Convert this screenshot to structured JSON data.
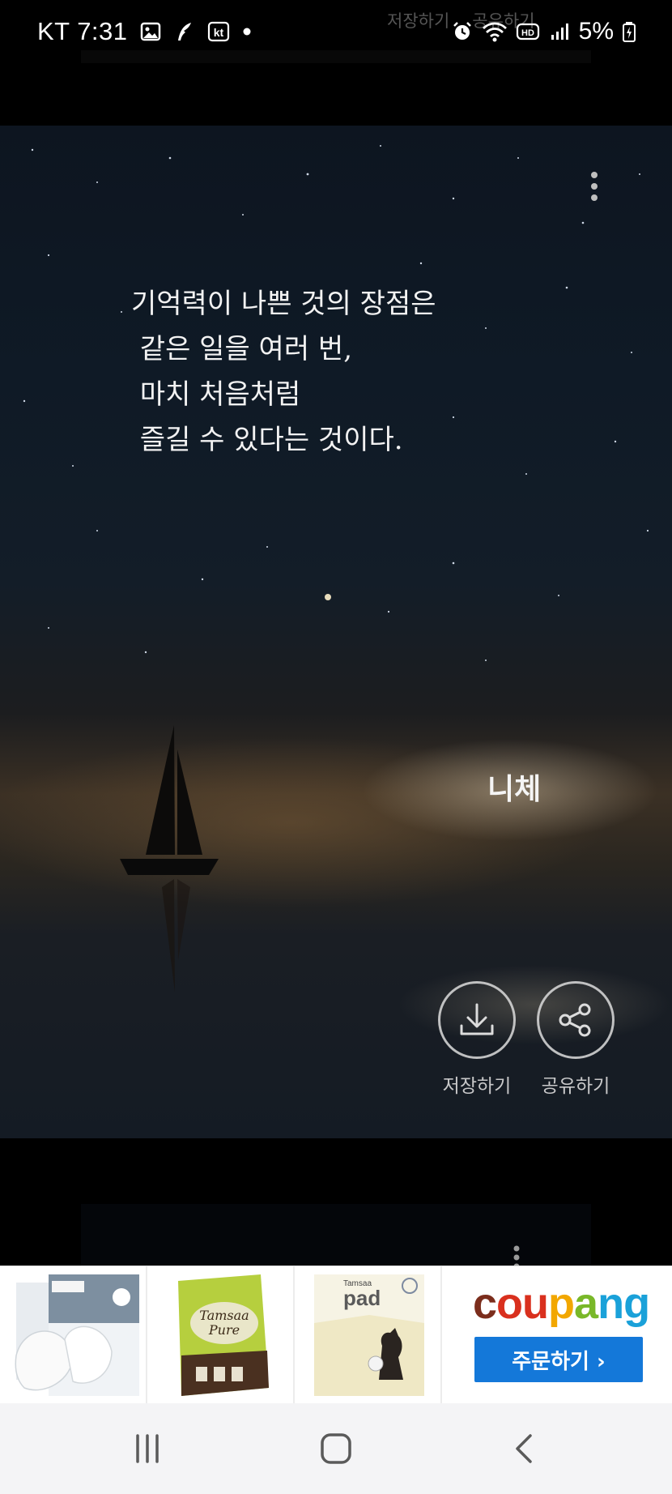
{
  "status_bar": {
    "carrier": "KT",
    "time": "7:31",
    "battery_percent": "5%",
    "left_icons": [
      "image-icon",
      "quill-icon",
      "kt-icon",
      "dot-icon"
    ],
    "right_icons": [
      "alarm-icon",
      "wifi-icon",
      "hd-icon",
      "signal-icon",
      "battery-icon"
    ]
  },
  "overlay_ghost": {
    "save_label": "저장하기",
    "share_label": "공유하기"
  },
  "quote": {
    "lines": [
      "기억력이 나쁜 것의 장점은",
      " 같은 일을 여러 번,",
      " 마치 처음처럼",
      " 즐길 수 있다는 것이다."
    ],
    "author": "니체"
  },
  "actions": {
    "save_label": "저장하기",
    "share_label": "공유하기"
  },
  "ad": {
    "brand": "coupang",
    "cta_label": "주문하기 ›",
    "products": [
      "mask-product",
      "tissue-product",
      "pet-pad-product"
    ],
    "brand_colors": [
      "#7b2d1c",
      "#d9301e",
      "#f2a700",
      "#79b829",
      "#1aa1d9"
    ]
  },
  "nav": {
    "buttons": [
      "recent-apps-icon",
      "home-icon",
      "back-icon"
    ]
  }
}
